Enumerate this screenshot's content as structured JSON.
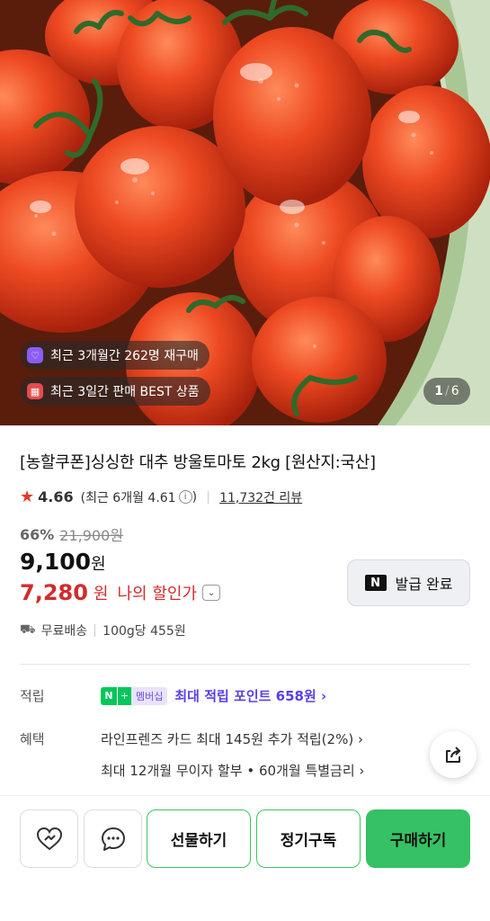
{
  "hero": {
    "badge_repurchase": "최근 3개월간 262명 재구매",
    "badge_best": "최근 3일간 판매 BEST 상품",
    "page_current": "1",
    "page_total": "6"
  },
  "product": {
    "title": "[농할쿠폰]싱싱한 대추 방울토마토 2kg [원산지:국산]",
    "rating": "4.66",
    "recent_rating": "(최근 6개월 4.61",
    "recent_rating_close": ")",
    "review_count": "11,732건 리뷰",
    "discount_rate": "66%",
    "original_price": "21,900원",
    "price": "9,100",
    "price_unit": "원",
    "my_price": "7,280",
    "my_price_unit": "원",
    "my_price_label": "나의 할인가",
    "shipping": "무료배송",
    "unit_price": "100g당 455원"
  },
  "coupon": {
    "label": "발급 완료",
    "logo": "N"
  },
  "points": {
    "label": "적립",
    "badge_n": "N",
    "badge_plus": "+",
    "badge_membership": "멤버십",
    "text": "최대 적립 포인트 658원 ›"
  },
  "benefit": {
    "label": "혜택",
    "line1": "라인프렌즈 카드 최대 145원 추가 적립(2%) ›",
    "line2": "최대 12개월 무이자 할부 • 60개월 특별금리 ›"
  },
  "actions": {
    "gift": "선물하기",
    "subscribe": "정기구독",
    "buy": "구매하기"
  }
}
